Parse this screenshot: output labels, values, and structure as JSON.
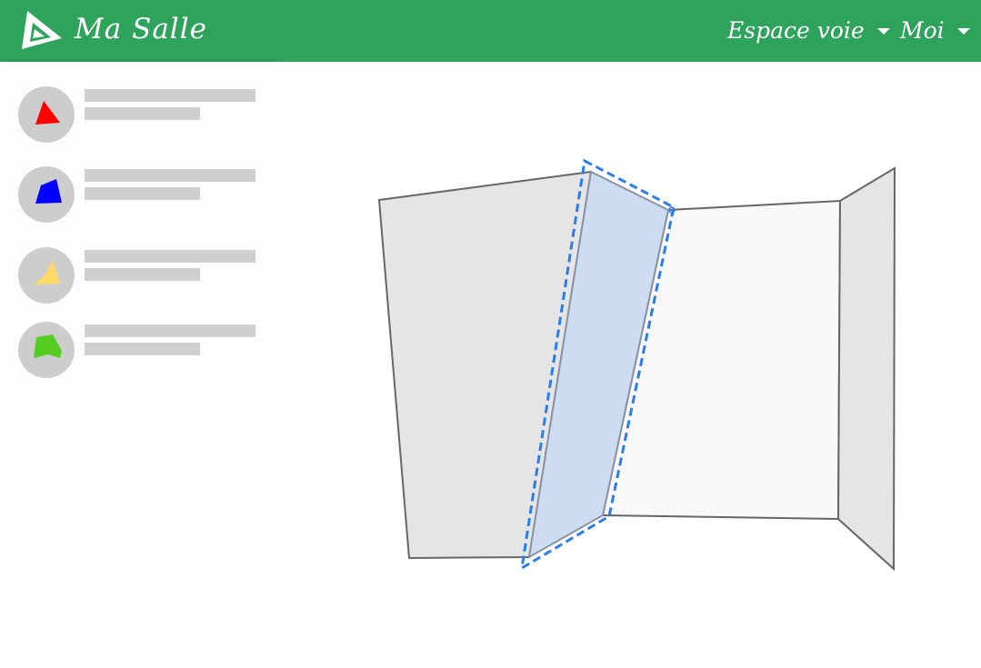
{
  "header": {
    "brand": "Ma Salle",
    "nav": {
      "espace_label": "Espace voie",
      "moi_label": "Moi"
    },
    "color": "#2ea35c"
  },
  "sidebar": {
    "items": [
      {
        "icon": "red-hold-icon",
        "color": "#ff0000"
      },
      {
        "icon": "blue-hold-icon",
        "color": "#0000ff"
      },
      {
        "icon": "yellow-hold-icon",
        "color": "#ffd966"
      },
      {
        "icon": "green-hold-icon",
        "color": "#55cc22"
      }
    ]
  },
  "wall": {
    "selected_panel_fill": "#cddcf0",
    "selection_outline": "#2b7de9",
    "panel_fill_dark": "#e5e5e5",
    "panel_fill_light": "#f8f8f8"
  }
}
